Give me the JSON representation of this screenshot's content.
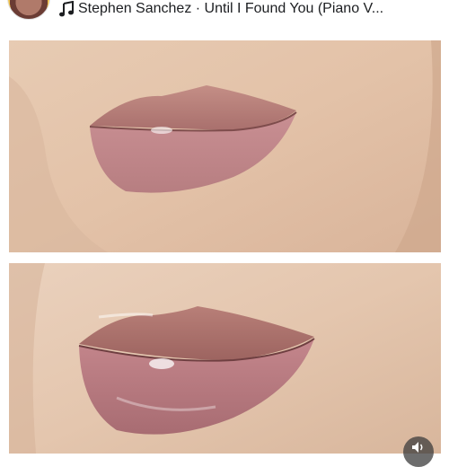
{
  "post": {
    "music": {
      "icon": "music-note-icon",
      "track": "Stephen Sanchez · Until I Found You (Piano V..."
    },
    "images": {
      "before_alt": "",
      "after_alt": ""
    },
    "controls": {
      "sound_icon": "speaker-icon"
    }
  }
}
